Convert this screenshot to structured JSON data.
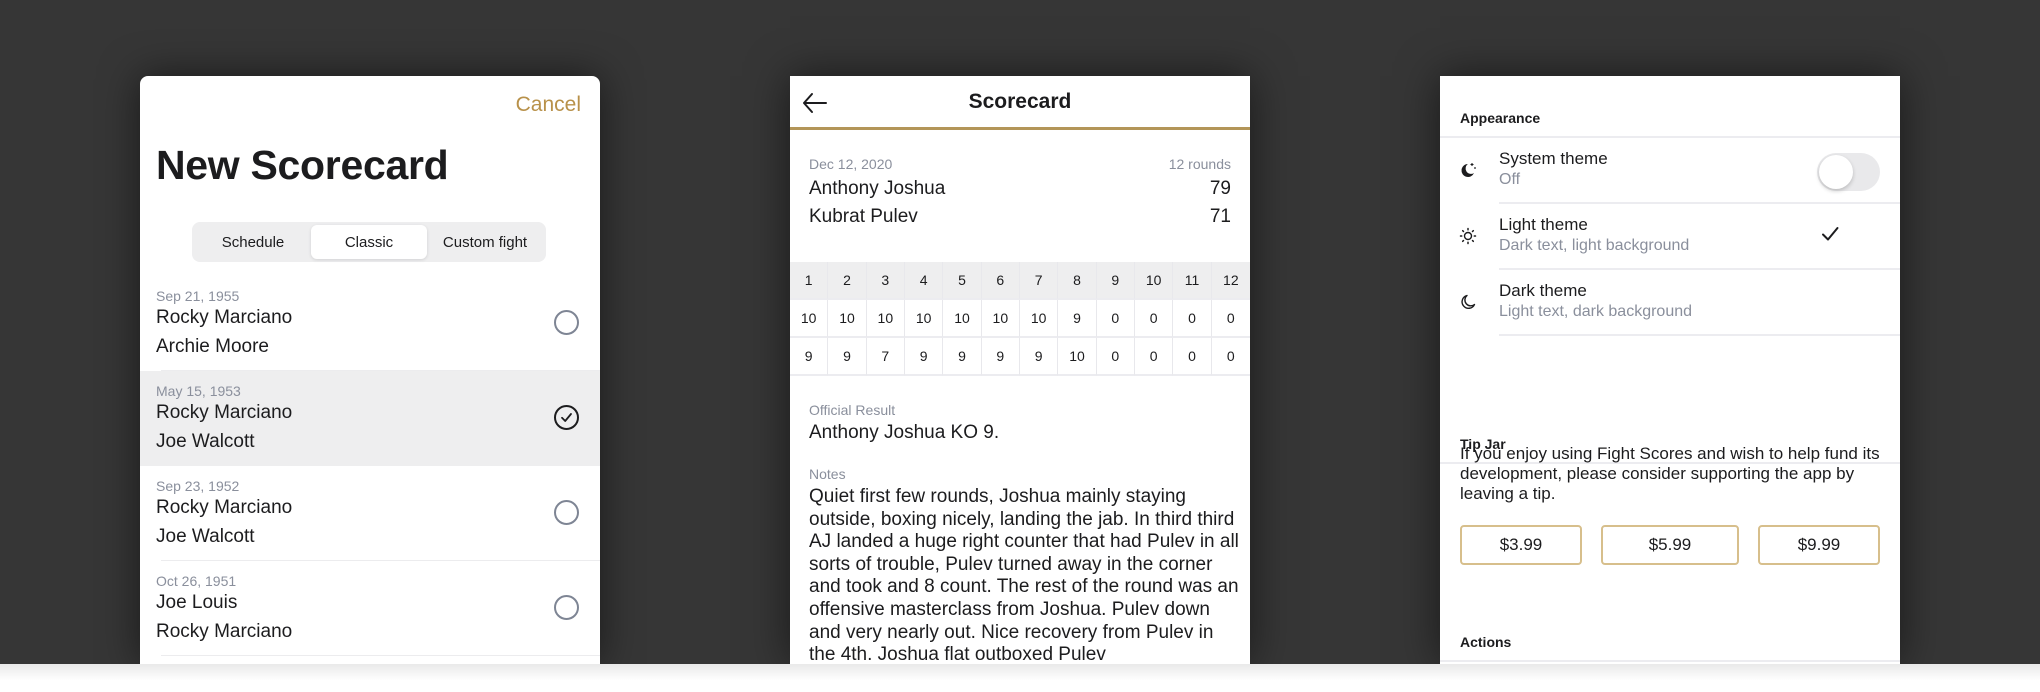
{
  "colors": {
    "accent": "#b8914a",
    "backdrop": "#363636",
    "secondary_text": "#8a8f9c",
    "selected_row": "#eeeeef"
  },
  "new_scorecard": {
    "cancel_label": "Cancel",
    "title": "New Scorecard",
    "segments": [
      {
        "label": "Schedule",
        "active": false
      },
      {
        "label": "Classic",
        "active": true
      },
      {
        "label": "Custom fight",
        "active": false
      }
    ],
    "fights": [
      {
        "date": "Sep 21, 1955",
        "fighter_a": "Rocky Marciano",
        "fighter_b": "Archie Moore",
        "selected": false
      },
      {
        "date": "May 15, 1953",
        "fighter_a": "Rocky Marciano",
        "fighter_b": "Joe Walcott",
        "selected": true
      },
      {
        "date": "Sep 23, 1952",
        "fighter_a": "Rocky Marciano",
        "fighter_b": "Joe Walcott",
        "selected": false
      },
      {
        "date": "Oct 26, 1951",
        "fighter_a": "Joe Louis",
        "fighter_b": "Rocky Marciano",
        "selected": false
      }
    ]
  },
  "scorecard": {
    "back_icon": "arrow-left-icon",
    "title": "Scorecard",
    "date": "Dec 12, 2020",
    "rounds_label": "12 rounds",
    "fighter_1": {
      "name": "Anthony Joshua",
      "total": "79"
    },
    "fighter_2": {
      "name": "Kubrat Pulev",
      "total": "71"
    },
    "round_numbers": [
      "1",
      "2",
      "3",
      "4",
      "5",
      "6",
      "7",
      "8",
      "9",
      "10",
      "11",
      "12"
    ],
    "fighter_1_scores": [
      "10",
      "10",
      "10",
      "10",
      "10",
      "10",
      "10",
      "9",
      "0",
      "0",
      "0",
      "0"
    ],
    "fighter_2_scores": [
      "9",
      "9",
      "7",
      "9",
      "9",
      "9",
      "9",
      "10",
      "0",
      "0",
      "0",
      "0"
    ],
    "official_result_label": "Official Result",
    "official_result": "Anthony Joshua KO 9.",
    "notes_label": "Notes",
    "notes": "Quiet first few rounds, Joshua mainly staying outside, boxing nicely, landing the jab. In third third AJ landed a huge right counter that had Pulev in all sorts of trouble, Pulev turned away in the corner and took and 8 count. The rest of the round was an offensive masterclass from Joshua. Pulev down and very nearly out. Nice recovery from Pulev in the 4th. Joshua flat outboxed Pulev"
  },
  "settings": {
    "appearance_header": "Appearance",
    "themes": [
      {
        "icon": "moon-stars-icon",
        "title": "System theme",
        "subtitle": "Off",
        "control": "toggle",
        "toggle_on": false
      },
      {
        "icon": "sun-icon",
        "title": "Light theme",
        "subtitle": "Dark text, light background",
        "control": "check",
        "checked": true
      },
      {
        "icon": "moon-icon",
        "title": "Dark theme",
        "subtitle": "Light text, dark background",
        "control": "check",
        "checked": false
      }
    ],
    "tip_jar_header": "Tip Jar",
    "tip_text": "If you enjoy using Fight Scores and wish to help fund its development, please consider supporting the app by leaving a tip.",
    "tips": [
      "$3.99",
      "$5.99",
      "$9.99"
    ],
    "actions_header": "Actions"
  }
}
